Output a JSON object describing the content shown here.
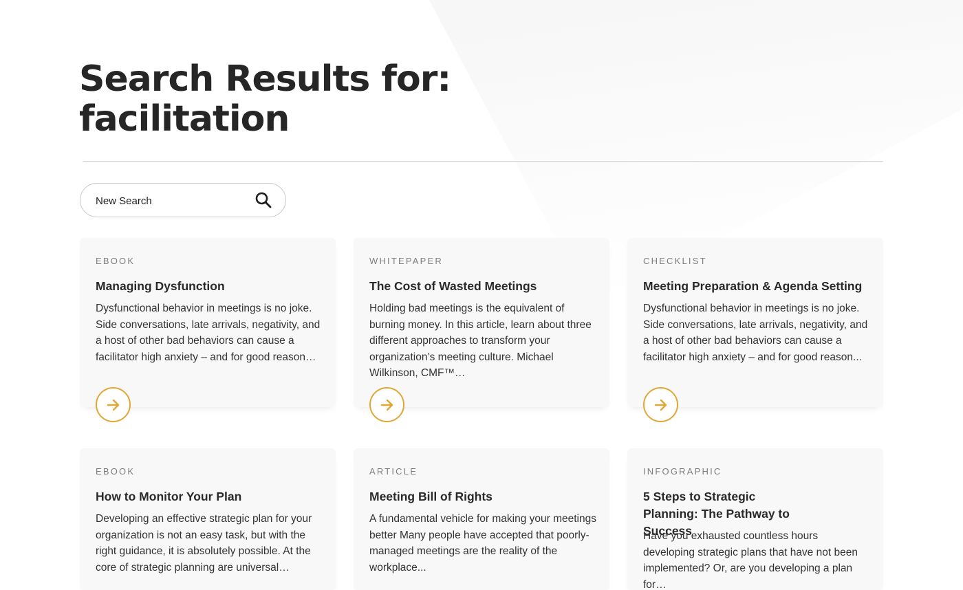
{
  "header": {
    "title_line1": "Search Results for:",
    "title_line2": "facilitation"
  },
  "search": {
    "placeholder": "New Search",
    "icon": "search-icon"
  },
  "accent_color": "#e0a734",
  "results": [
    {
      "category": "EBOOK",
      "title": "Managing Dysfunction",
      "description": "Dysfunctional behavior in meetings is no joke. Side conversations, late arrivals, negativity, and a host of other bad behaviors can cause a facilitator high anxiety – and for good reason…",
      "icon": "arrow-right-icon"
    },
    {
      "category": "WHITEPAPER",
      "title": "The Cost of Wasted Meetings",
      "description": "Holding bad meetings is the equivalent of burning money. In this article, learn about three different approaches to transform your organization’s meeting culture. Michael Wilkinson, CMF™…",
      "icon": "arrow-right-icon"
    },
    {
      "category": "CHECKLIST",
      "title": "Meeting Preparation & Agenda Setting",
      "description": "Dysfunctional behavior in meetings is no joke. Side conversations, late arrivals, negativity, and a host of other bad behaviors can cause a facilitator high anxiety – and for good reason...",
      "icon": "arrow-right-icon"
    },
    {
      "category": "EBOOK",
      "title": "How to Monitor Your Plan",
      "description": "Developing an effective strategic plan for your organization is not an easy task, but with the right guidance, it is absolutely possible. At the core of strategic planning are universal…"
    },
    {
      "category": "ARTICLE",
      "title": "Meeting Bill of Rights",
      "description": "A fundamental vehicle for making your meetings better   Many people have accepted that poorly-managed meetings are the reality of the workplace..."
    },
    {
      "category": "INFOGRAPHIC",
      "title": "5 Steps to Strategic Planning: The Pathway to Success",
      "description": "Have you exhausted countless hours developing strategic plans that have not been implemented? Or, are you developing a plan for…"
    }
  ]
}
